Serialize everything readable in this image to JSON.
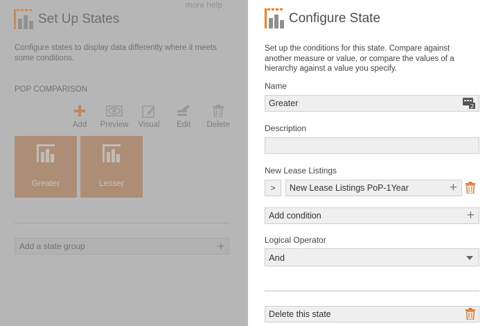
{
  "left_panel": {
    "more_help": "more help",
    "title": "Set Up States",
    "description": "Configure states to display data differently where it meets some conditions.",
    "section_label": "POP COMPARISON",
    "toolbar": [
      {
        "label": "Add",
        "icon": "plus-icon"
      },
      {
        "label": "Preview",
        "icon": "eye-icon"
      },
      {
        "label": "Visual",
        "icon": "pencil-square-icon"
      },
      {
        "label": "Edit",
        "icon": "edit-icon"
      },
      {
        "label": "Delete",
        "icon": "trash-icon"
      }
    ],
    "states": [
      {
        "label": "Greater",
        "icon": "state-chart-icon"
      },
      {
        "label": "Lesser",
        "icon": "state-chart-icon"
      }
    ],
    "add_state_group": "Add a state group"
  },
  "right_panel": {
    "title": "Configure State",
    "description": "Set up the conditions for this state. Compare against another measure or value, or compare the values of a hierarchy against a value you specify.",
    "name_label": "Name",
    "name_value": "Greater",
    "description_label": "Description",
    "description_value": "",
    "condition_label": "New Lease Listings",
    "condition_operator": ">",
    "condition_value": "New Lease Listings PoP-1Year",
    "add_condition": "Add condition",
    "logical_operator_label": "Logical Operator",
    "logical_operator_value": "And",
    "delete_state": "Delete this state"
  },
  "colors": {
    "accent": "#ff7a1a",
    "tile": "#c0865a",
    "left_bg": "#cfcfcf"
  }
}
